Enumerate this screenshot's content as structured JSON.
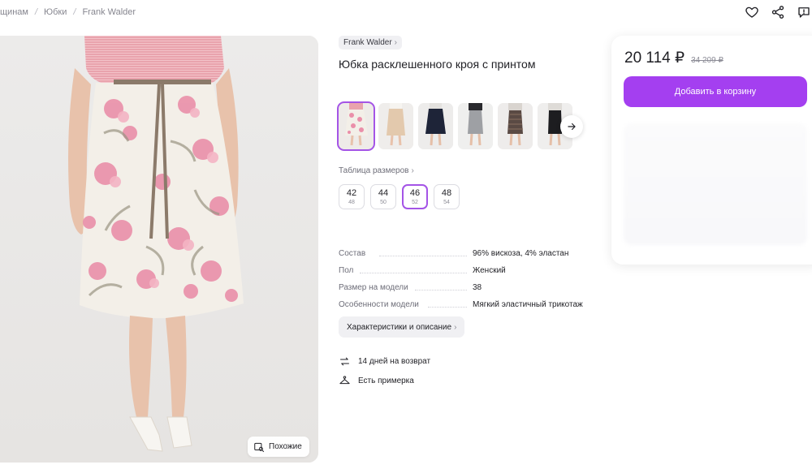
{
  "breadcrumbs": [
    "щинам",
    "Юбки",
    "Frank Walder"
  ],
  "header_icons": [
    "heart-icon",
    "share-icon",
    "chat-icon"
  ],
  "product": {
    "brand": "Frank Walder",
    "title": "Юбка расклешенного кроя с принтом"
  },
  "gallery": {
    "similar_label": "Похожие",
    "thumbnails_count": 6,
    "selected_thumbnail": 0
  },
  "size_table_label": "Таблица размеров",
  "sizes": [
    {
      "main": "42",
      "sub": "48",
      "selected": false
    },
    {
      "main": "44",
      "sub": "50",
      "selected": false
    },
    {
      "main": "46",
      "sub": "52",
      "selected": true
    },
    {
      "main": "48",
      "sub": "54",
      "selected": false
    }
  ],
  "specs": [
    {
      "key": "Состав",
      "value": "96% вискоза, 4% эластан"
    },
    {
      "key": "Пол",
      "value": "Женский"
    },
    {
      "key": "Размер на модели",
      "value": "38"
    },
    {
      "key": "Особенности модели",
      "value": "Мягкий эластичный трикотаж"
    }
  ],
  "description_button": "Характеристики и описание",
  "info": [
    {
      "icon": "return-arrows-icon",
      "text": "14 дней на возврат"
    },
    {
      "icon": "hanger-icon",
      "text": "Есть примерка"
    }
  ],
  "buy": {
    "price": "20 114 ₽",
    "old_price": "34 209 ₽",
    "add_to_cart": "Добавить в корзину"
  },
  "colors": {
    "accent": "#a43ff0",
    "selected_outline": "#a454e6"
  }
}
